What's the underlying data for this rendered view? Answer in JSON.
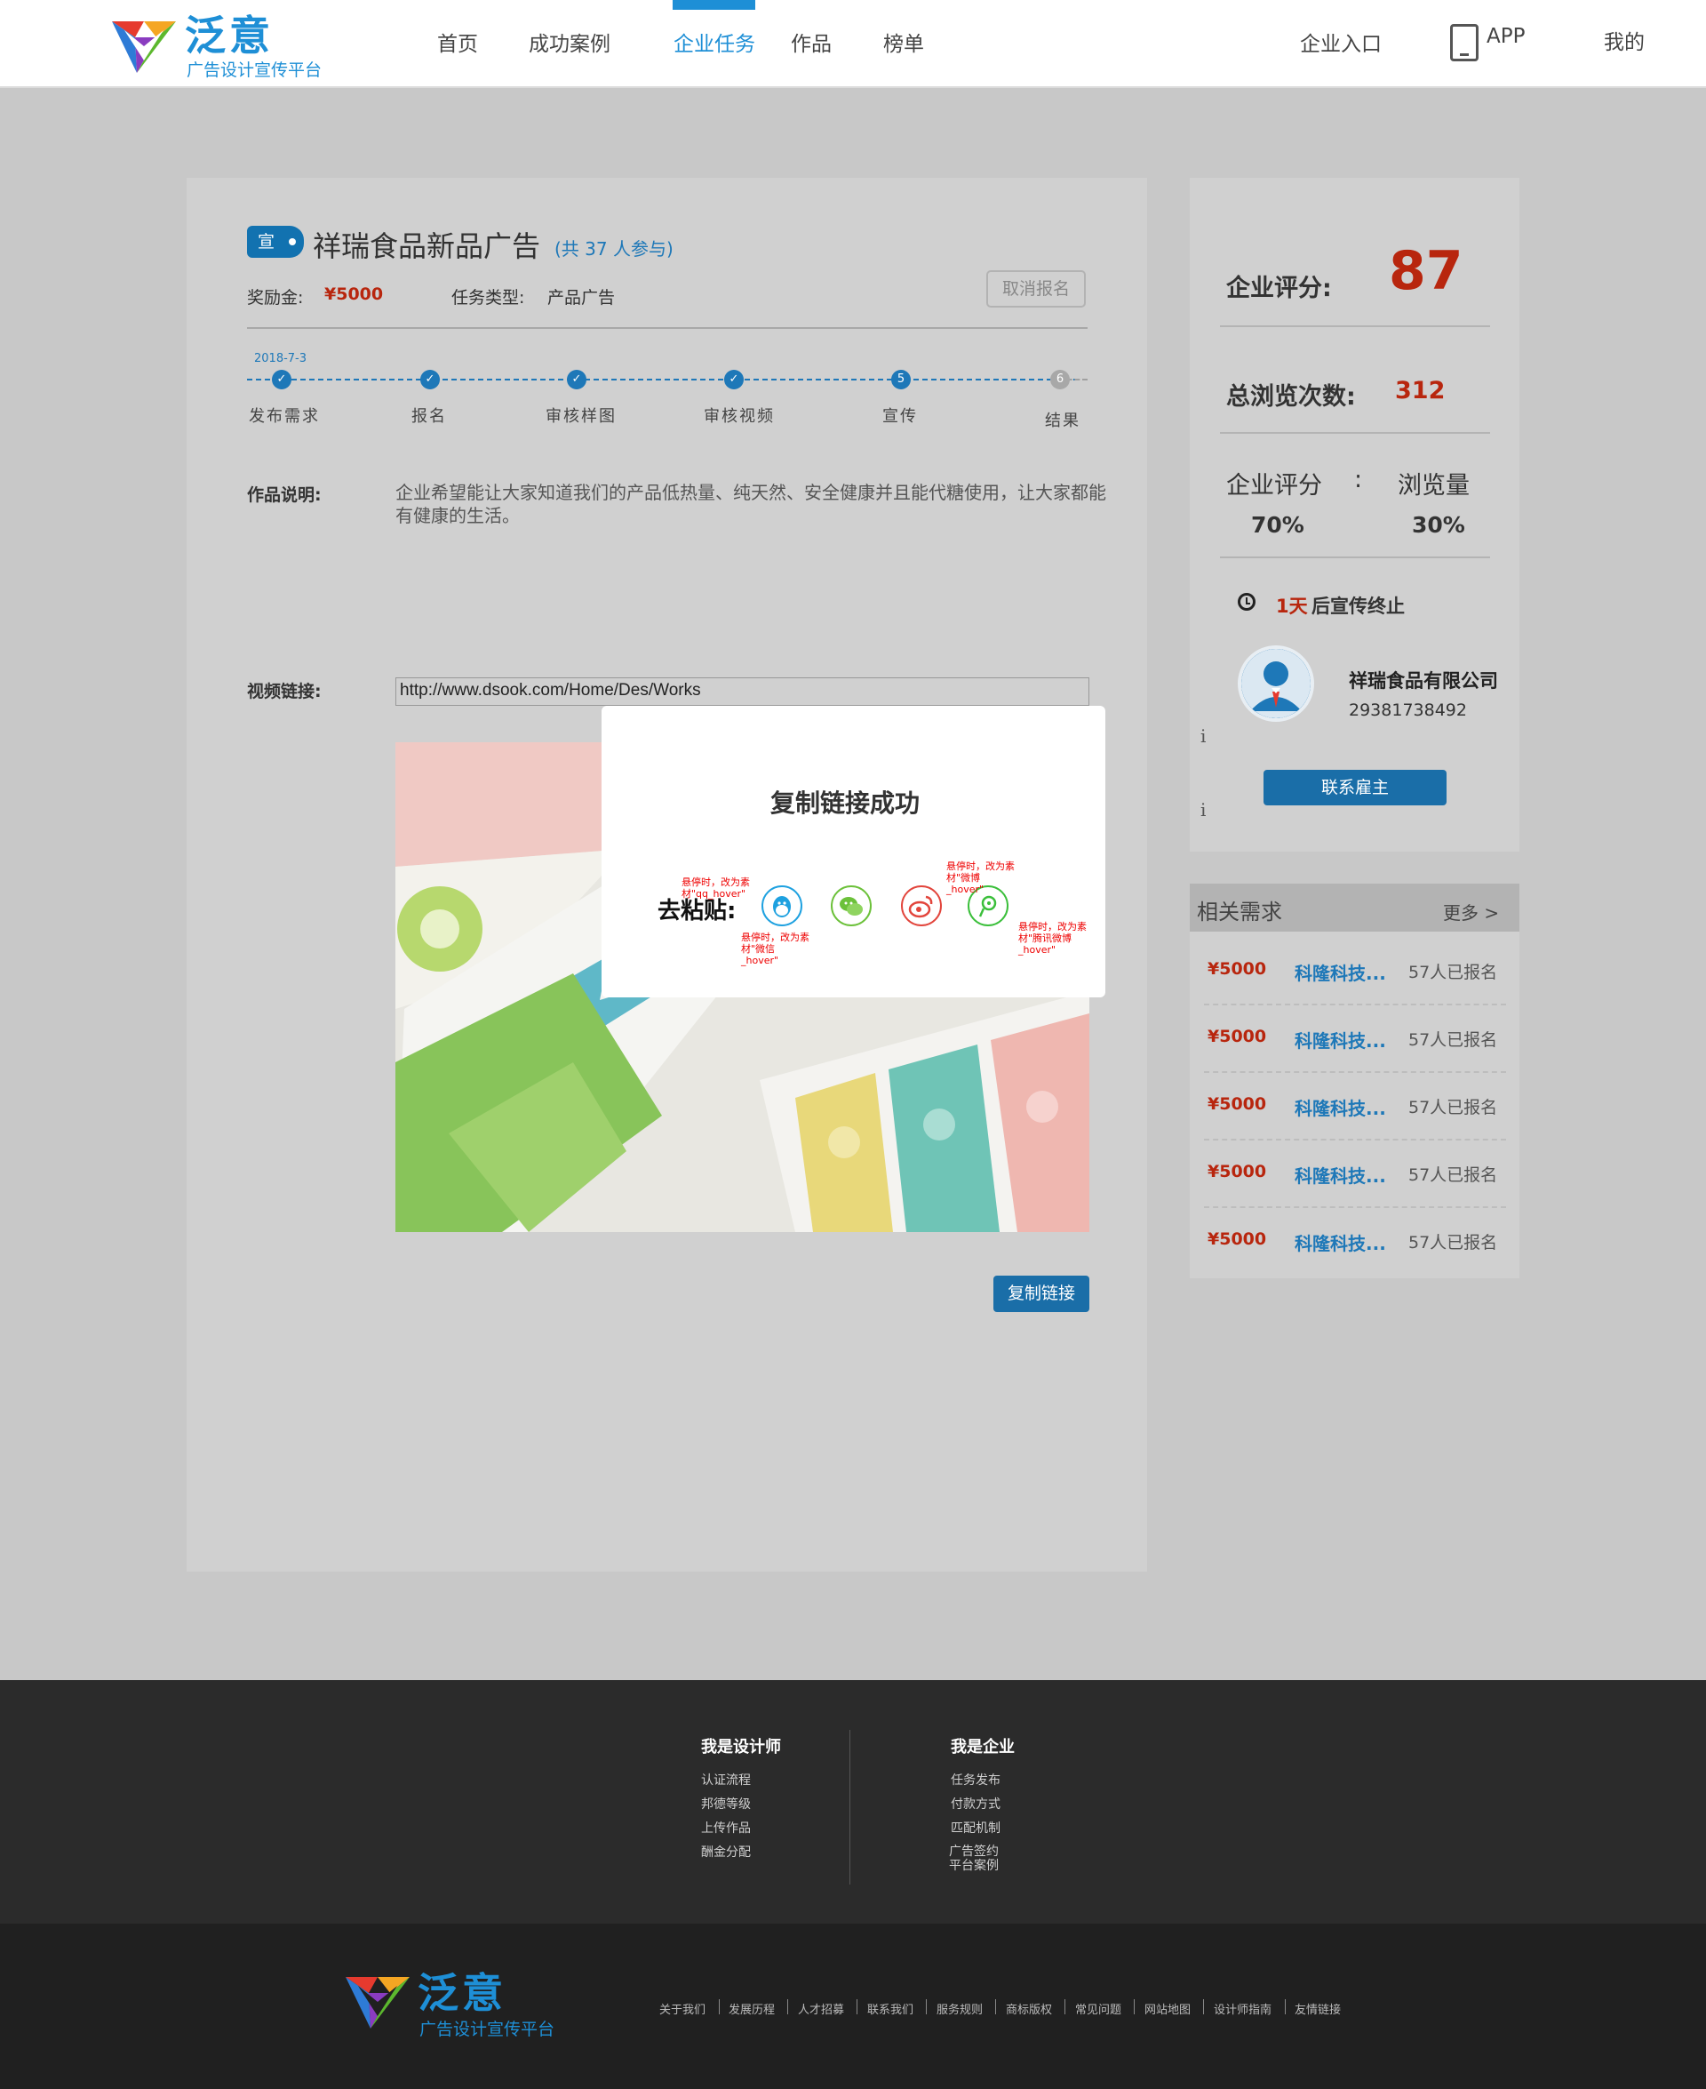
{
  "header": {
    "logo_title": "泛意",
    "logo_sub": "广告设计宣传平台",
    "nav": [
      "首页",
      "成功案例",
      "企业任务",
      "作品",
      "榜单"
    ],
    "right_nav": {
      "enterprise": "企业入口",
      "app": "APP",
      "mine": "我的"
    }
  },
  "task": {
    "tag": "宣",
    "title": "祥瑞食品新品广告",
    "participants": "(共 37 人参与)",
    "reward_label": "奖励金:",
    "reward_value": "¥5000",
    "type_label": "任务类型:",
    "type_value": "产品广告",
    "cancel_button": "取消报名",
    "date": "2018-7-3",
    "steps": [
      "发布需求",
      "报名",
      "审核样图",
      "审核视频",
      "宣传",
      "结果"
    ],
    "step_numbers": {
      "five": "5",
      "six": "6"
    },
    "desc_label": "作品说明:",
    "desc_text": "企业希望能让大家知道我们的产品低热量、纯天然、安全健康并且能代糖使用，让大家都能有健康的生活。",
    "video_label": "视频链接:",
    "video_url": "http://www.dsook.com/Home/Des/Works",
    "copy_button": "复制链接"
  },
  "side": {
    "score_label": "企业评分:",
    "score_value": "87",
    "views_label": "总浏览次数:",
    "views_value": "312",
    "ratio_left": "企业评分",
    "ratio_colon": ":",
    "ratio_right": "浏览量",
    "ratio_left_value": "70%",
    "ratio_right_value": "30%",
    "countdown_value": "1天",
    "countdown_text": "后宣传终止",
    "company_name": "祥瑞食品有限公司",
    "company_phone": "29381738492",
    "contact_button": "联系雇主"
  },
  "related": {
    "title": "相关需求",
    "more": "更多 >",
    "items": [
      {
        "price": "¥5000",
        "name": "科隆科技...",
        "count": "57人已报名"
      },
      {
        "price": "¥5000",
        "name": "科隆科技...",
        "count": "57人已报名"
      },
      {
        "price": "¥5000",
        "name": "科隆科技...",
        "count": "57人已报名"
      },
      {
        "price": "¥5000",
        "name": "科隆科技...",
        "count": "57人已报名"
      },
      {
        "price": "¥5000",
        "name": "科隆科技...",
        "count": "57人已报名"
      }
    ]
  },
  "modal": {
    "title": "复制链接成功",
    "share_label": "去粘贴:",
    "annotations": {
      "qq": "悬停时，改为素\n材\"qq_hover\"",
      "wechat": "悬停时，改为素\n材\"微信\n_hover\"",
      "weibo": "悬停时，改为素\n材\"微博\n_hover\"",
      "tencent": "悬停时，改为素\n材\"腾讯微博\n_hover\""
    }
  },
  "footer": {
    "designer_title": "我是设计师",
    "designer_links": [
      "认证流程",
      "邦德等级",
      "上传作品",
      "酬金分配"
    ],
    "enterprise_title": "我是企业",
    "enterprise_links": [
      "任务发布",
      "付款方式",
      "匹配机制",
      "广告签约\n平台案例"
    ],
    "bottom_links": [
      "关于我们",
      "发展历程",
      "人才招募",
      "联系我们",
      "服务规则",
      "商标版权",
      "常见问题",
      "网站地图",
      "设计师指南",
      "友情链接"
    ]
  },
  "colors": {
    "brand_blue": "#1e8fd6",
    "button_blue": "#1a6ea8",
    "price_red": "#b8260e"
  }
}
